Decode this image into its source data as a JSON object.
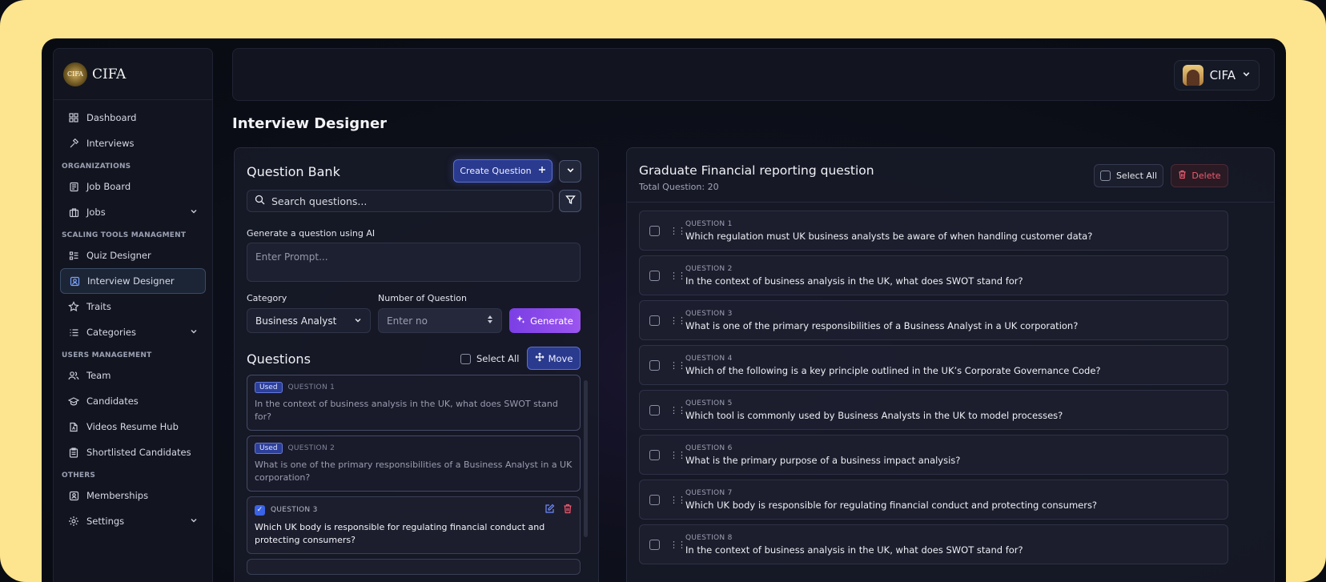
{
  "brand": {
    "name": "CIFA",
    "logo_text": "CIFA"
  },
  "sidebar": {
    "items_top": [
      {
        "label": "Dashboard",
        "icon": "dashboard-icon"
      },
      {
        "label": "Interviews",
        "icon": "gavel-icon"
      }
    ],
    "section_org": "ORGANIZATIONS",
    "items_org": [
      {
        "label": "Job Board",
        "icon": "newspaper-icon"
      },
      {
        "label": "Jobs",
        "icon": "briefcase-icon",
        "expandable": true
      }
    ],
    "section_scaling": "SCALING TOOLS MANAGMENT",
    "items_scaling": [
      {
        "label": "Quiz Designer",
        "icon": "list-icon"
      },
      {
        "label": "Interview Designer",
        "icon": "contact-icon",
        "active": true
      },
      {
        "label": "Traits",
        "icon": "star-icon"
      },
      {
        "label": "Categories",
        "icon": "categories-icon",
        "expandable": true
      }
    ],
    "section_users": "USERS MANAGEMENT",
    "items_users": [
      {
        "label": "Team",
        "icon": "users-icon"
      },
      {
        "label": "Candidates",
        "icon": "graduation-cap-icon"
      },
      {
        "label": "Videos Resume Hub",
        "icon": "file-icon"
      },
      {
        "label": "Shortlisted Candidates",
        "icon": "clipboard-icon"
      }
    ],
    "section_others": "OTHERS",
    "items_others": [
      {
        "label": "Memberships",
        "icon": "id-card-icon"
      },
      {
        "label": "Settings",
        "icon": "gear-icon",
        "expandable": true
      }
    ]
  },
  "header": {
    "profile_name": "CIFA"
  },
  "page": {
    "title": "Interview Designer"
  },
  "question_bank": {
    "title": "Question Bank",
    "create_label": "Create Question",
    "search_placeholder": "Search questions...",
    "ai_label": "Generate a question using AI",
    "prompt_placeholder": "Enter Prompt...",
    "category_label": "Category",
    "category_value": "Business Analyst",
    "number_label": "Number of Question",
    "number_placeholder": "Enter no",
    "generate_label": "Generate",
    "questions_title": "Questions",
    "select_all_label": "Select All",
    "move_label": "Move",
    "questions": [
      {
        "badge": "Used",
        "number": "QUESTION 1",
        "text": "In the context of business analysis in the UK, what does SWOT stand for?"
      },
      {
        "badge": "Used",
        "number": "QUESTION 2",
        "text": "What is one of the primary responsibilities of a Business Analyst in a UK corporation?"
      },
      {
        "number": "QUESTION 3",
        "text": "Which UK body is responsible for regulating financial conduct and protecting consumers?",
        "checked": true
      }
    ]
  },
  "right_panel": {
    "title": "Graduate Financial reporting question",
    "subtitle": "Total Question: 20",
    "select_all_label": "Select All",
    "delete_label": "Delete",
    "questions": [
      {
        "number": "QUESTION 1",
        "text": "Which regulation must UK business analysts be aware of when handling customer data?"
      },
      {
        "number": "QUESTION 2",
        "text": "In the context of business analysis in the UK, what does SWOT stand for?"
      },
      {
        "number": "QUESTION 3",
        "text": "What is one of the primary responsibilities of a Business Analyst in a UK corporation?"
      },
      {
        "number": "QUESTION 4",
        "text": "Which of the following is a key principle outlined in the UK’s Corporate Governance Code?"
      },
      {
        "number": "QUESTION 5",
        "text": "Which tool is commonly used by Business Analysts in the UK to model processes?"
      },
      {
        "number": "QUESTION 6",
        "text": "What is the primary purpose of a business impact analysis?"
      },
      {
        "number": "QUESTION 7",
        "text": "Which UK body is responsible for regulating financial conduct and protecting consumers?"
      },
      {
        "number": "QUESTION 8",
        "text": "In the context of business analysis in the UK, what does SWOT stand for?"
      }
    ]
  },
  "colors": {
    "frame": "#fde48e",
    "accent": "#2a3a8e",
    "generate": "#8b4be8",
    "danger": "#f05a6e"
  }
}
